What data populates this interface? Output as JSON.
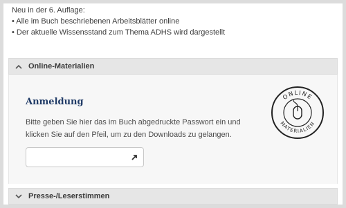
{
  "intro": {
    "line1": "Neu in der 6. Auflage:",
    "line2": "• Alle im Buch beschriebenen Arbeitsblätter online",
    "line3": "• Der aktuelle Wissensstand zum Thema ADHS wird dargestellt"
  },
  "accordion": {
    "online": {
      "label": "Online-Materialien",
      "icon": "chevron-up-icon"
    },
    "presse": {
      "label": "Presse-/Leserstimmen",
      "icon": "chevron-down-icon"
    }
  },
  "login": {
    "title": "Anmeldung",
    "desc_line1": "Bitte geben Sie hier das im Buch abgedruckte Passwort ein und",
    "desc_line2": "klicken Sie auf den Pfeil, um zu den Downloads zu gelangen.",
    "password_value": "",
    "submit_icon": "arrow-right-icon"
  },
  "badge": {
    "top_text": "ONLINE",
    "bottom_text": "MATERIALIEN",
    "icon": "mouse-icon"
  },
  "colors": {
    "heading": "#1f3a66",
    "header_bg": "#e6e6e6",
    "panel_bg": "#f7f7f7"
  }
}
